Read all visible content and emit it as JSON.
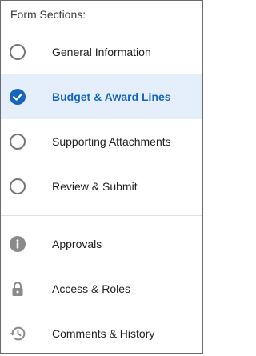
{
  "panel": {
    "title": "Form Sections:"
  },
  "sections": [
    {
      "label": "General Information",
      "state": "unchecked"
    },
    {
      "label": "Budget & Award Lines",
      "state": "checked"
    },
    {
      "label": "Supporting Attachments",
      "state": "unchecked"
    },
    {
      "label": "Review & Submit",
      "state": "unchecked"
    }
  ],
  "links": [
    {
      "label": "Approvals",
      "icon": "info-icon"
    },
    {
      "label": "Access & Roles",
      "icon": "lock-icon"
    },
    {
      "label": "Comments & History",
      "icon": "history-icon"
    }
  ],
  "colors": {
    "active_background": "#e5effb",
    "active_text": "#1565c0",
    "check_fill": "#1565c0",
    "icon_gray": "#8a8a8a"
  }
}
